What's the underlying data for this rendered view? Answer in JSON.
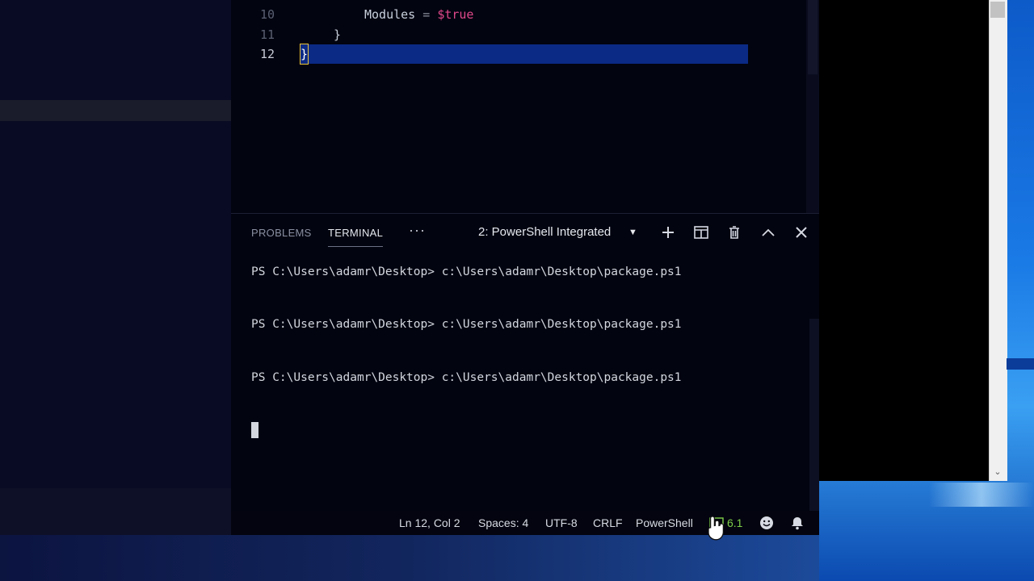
{
  "editor": {
    "lines": [
      {
        "num": "10",
        "indent": "        ",
        "prop": "Modules",
        "op": " = ",
        "value": "$true"
      },
      {
        "num": "11",
        "indent": "    ",
        "brace": "}"
      },
      {
        "num": "12",
        "indent": "",
        "brace": "}"
      }
    ]
  },
  "panel": {
    "tabs": [
      "PROBLEMS",
      "TERMINAL"
    ],
    "more": "···",
    "terminal_select": "2: PowerShell Integrated",
    "terminal_lines": [
      "PS C:\\Users\\adamr\\Desktop> c:\\Users\\adamr\\Desktop\\package.ps1",
      "PS C:\\Users\\adamr\\Desktop> c:\\Users\\adamr\\Desktop\\package.ps1",
      "PS C:\\Users\\adamr\\Desktop> c:\\Users\\adamr\\Desktop\\package.ps1"
    ]
  },
  "statusbar": {
    "position": "Ln 12, Col 2",
    "spaces": "Spaces: 4",
    "encoding": "UTF-8",
    "eol": "CRLF",
    "language": "PowerShell",
    "ps_version": "6.1"
  },
  "colors": {
    "selection": "#0b2a85",
    "variable": "#e0488a",
    "version_green": "#7fcf4a",
    "background": "#020410"
  },
  "icons": [
    "plus-icon",
    "split-icon",
    "trash-icon",
    "chevron-up-icon",
    "close-icon",
    "terminal-version-icon",
    "smiley-icon",
    "bell-icon"
  ]
}
